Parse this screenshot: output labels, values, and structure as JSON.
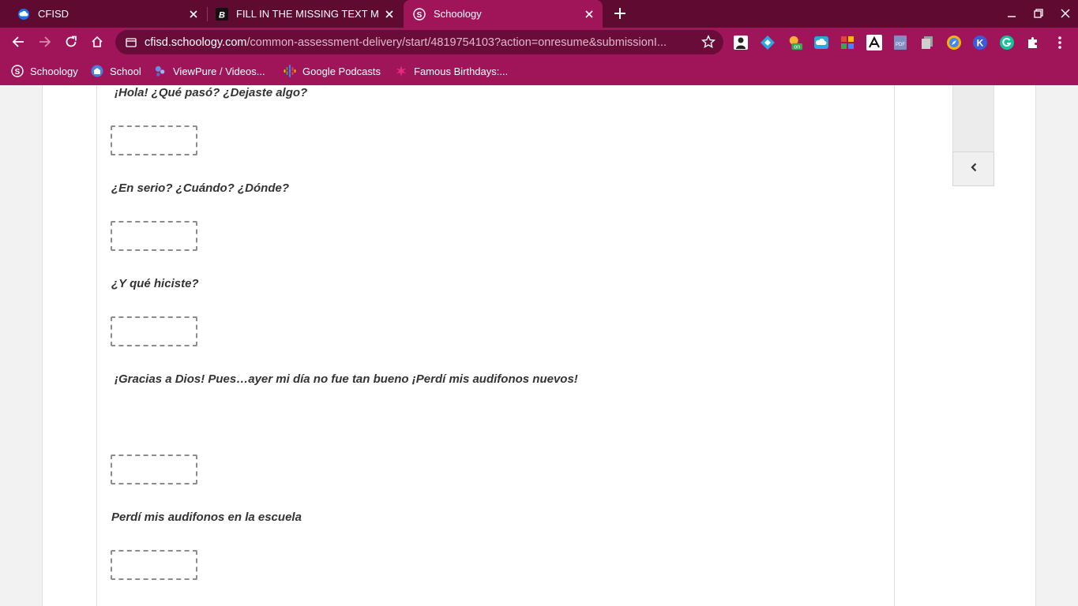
{
  "browser": {
    "tabs": [
      {
        "title": "CFISD",
        "favicon": "cloud-icon"
      },
      {
        "title": "FILL IN THE MISSING TEXT MES",
        "favicon": "bold-b-icon"
      },
      {
        "title": "Schoology",
        "favicon": "schoology-icon"
      }
    ],
    "active_tab": 2,
    "url_host": "cfisd.schoology.com",
    "url_path": "/common-assessment-delivery/start/4819754103?action=onresume&submissionI...",
    "bookmarks": [
      {
        "label": "Schoology",
        "icon": "schoology-icon"
      },
      {
        "label": "School",
        "icon": "school-icon"
      },
      {
        "label": "ViewPure / Videos...",
        "icon": "viewpure-icon"
      },
      {
        "label": "Google Podcasts",
        "icon": "podcasts-icon"
      },
      {
        "label": "Famous Birthdays:...",
        "icon": "star-burst-icon"
      }
    ],
    "extension_badge": "on"
  },
  "colors": {
    "tabstrip": "#5e0a31",
    "toolbar": "#a0155a",
    "omnibox": "#6a0c39",
    "dashed_border": "#8c8c8c"
  },
  "assessment": {
    "lines": [
      "¡Hola! ¿Qué pasó? ¿Dejaste algo?",
      "¿En serio? ¿Cuándo? ¿Dónde?",
      "¿Y qué hiciste?",
      "¡Gracias a Dios! Pues…ayer mi día no fue tan bueno ¡Perdí mis audifonos nuevos!",
      "Perdí mis audifonos en la escuela"
    ]
  }
}
